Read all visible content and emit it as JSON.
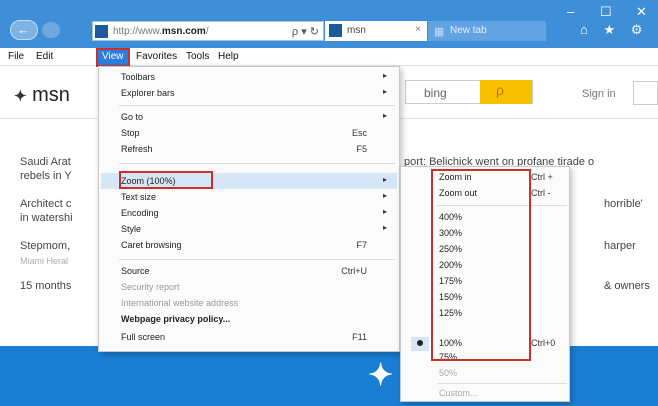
{
  "browser": {
    "address_text_prefix": "http://www.",
    "address_text_domain": "msn.com",
    "address_text_suffix": "/",
    "address_icons": "ρ ▾ ↻",
    "tab_active_label": "msn",
    "tab_active_close": "×",
    "tab_new_label": "New tab",
    "window_controls": [
      "–",
      "☐",
      "✕"
    ],
    "toolbar_icons": "⌂ ★ ⚙"
  },
  "menubar": {
    "items": [
      {
        "label": "File"
      },
      {
        "label": "Edit"
      },
      {
        "label": "View"
      },
      {
        "label": "Favorites"
      },
      {
        "label": "Tools"
      },
      {
        "label": "Help"
      }
    ]
  },
  "page": {
    "logo_text": "msn",
    "search_placeholder": "bing",
    "signin_label": "Sign in",
    "headlines_left": [
      {
        "text": "Saudi Arat",
        "sub": "rebels in Y"
      },
      {
        "text": "Architect c",
        "sub": "in watershi"
      },
      {
        "text": "Stepmom,",
        "sub": "Miami Heral"
      },
      {
        "text": "15 months",
        "sub": ""
      }
    ],
    "headlines_right": [
      "port: Belichick went on profane tirade o",
      "horrible'",
      "harper",
      "& owners"
    ]
  },
  "view_menu": {
    "items": [
      {
        "label": "Toolbars",
        "shortcut": "",
        "submenu": true
      },
      {
        "label": "Explorer bars",
        "shortcut": "",
        "submenu": true
      },
      {
        "label": "Go to",
        "shortcut": "",
        "submenu": true
      },
      {
        "label": "Stop",
        "shortcut": "Esc",
        "submenu": false
      },
      {
        "label": "Refresh",
        "shortcut": "F5",
        "submenu": false
      },
      {
        "label": "Zoom (100%)",
        "shortcut": "",
        "submenu": true
      },
      {
        "label": "Text size",
        "shortcut": "",
        "submenu": true
      },
      {
        "label": "Encoding",
        "shortcut": "",
        "submenu": true
      },
      {
        "label": "Style",
        "shortcut": "",
        "submenu": true
      },
      {
        "label": "Caret browsing",
        "shortcut": "F7",
        "submenu": false
      },
      {
        "label": "Source",
        "shortcut": "Ctrl+U",
        "submenu": false
      },
      {
        "label": "Security report",
        "shortcut": "",
        "submenu": false
      },
      {
        "label": "International website address",
        "shortcut": "",
        "submenu": false
      },
      {
        "label": "Webpage privacy policy...",
        "shortcut": "",
        "submenu": false
      },
      {
        "label": "Full screen",
        "shortcut": "F11",
        "submenu": false
      }
    ]
  },
  "zoom_menu": {
    "items": [
      {
        "label": "Zoom in",
        "shortcut": "Ctrl +"
      },
      {
        "label": "Zoom out",
        "shortcut": "Ctrl -"
      },
      {
        "label": "400%",
        "shortcut": ""
      },
      {
        "label": "300%",
        "shortcut": ""
      },
      {
        "label": "250%",
        "shortcut": ""
      },
      {
        "label": "200%",
        "shortcut": ""
      },
      {
        "label": "175%",
        "shortcut": ""
      },
      {
        "label": "150%",
        "shortcut": ""
      },
      {
        "label": "125%",
        "shortcut": ""
      },
      {
        "label": "100%",
        "shortcut": "Ctrl+0"
      },
      {
        "label": "75%",
        "shortcut": ""
      },
      {
        "label": "50%",
        "shortcut": ""
      },
      {
        "label": "Custom...",
        "shortcut": ""
      }
    ],
    "selected_label": "100%"
  }
}
